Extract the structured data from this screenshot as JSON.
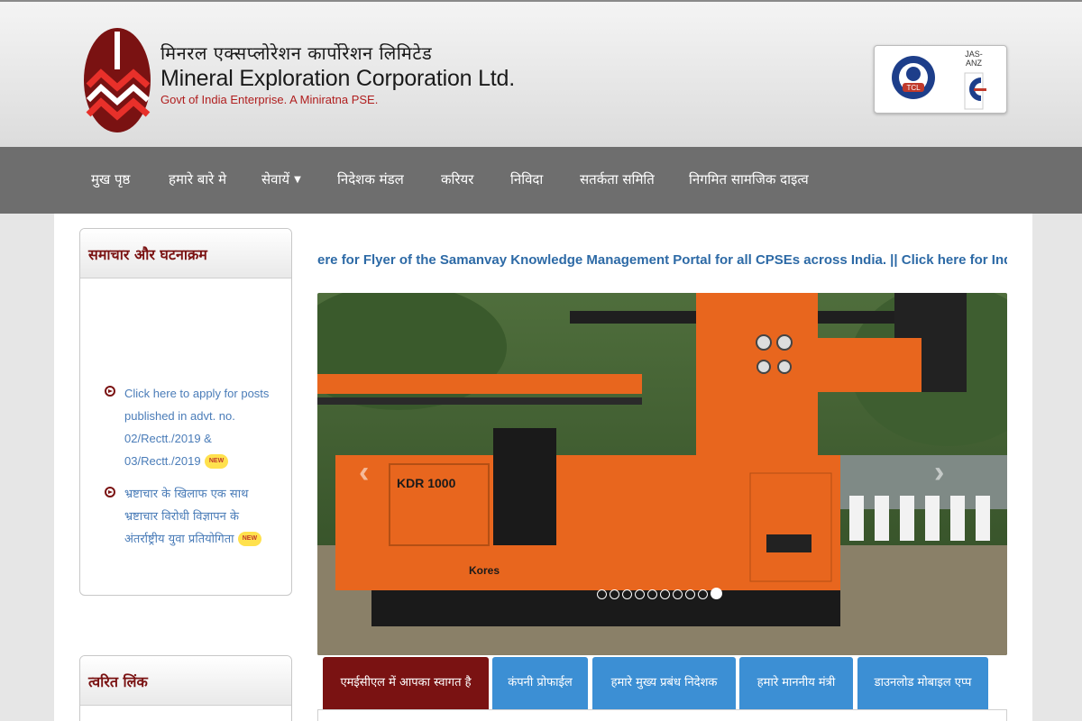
{
  "header": {
    "title_hindi": "मिनरल एक्सप्लोरेशन कार्पोरेशन लिमिटेड",
    "title_english": "Mineral Exploration Corporation Ltd.",
    "subtitle": "Govt of India Enterprise. A Miniratna PSE.",
    "cert_tcl_label": "TCL",
    "cert_jas_label": "JAS-ANZ"
  },
  "nav": {
    "items": [
      "मुख पृष्ठ",
      "हमारे बारे मे",
      "सेवायें",
      "निदेशक मंडल",
      "करियर",
      "निविदा",
      "सतर्कता समिति",
      "निगमित सामजिक दाइत्व"
    ]
  },
  "news": {
    "heading": "समाचार और घटनाक्रम",
    "items": [
      {
        "text": "Click here to apply for posts published in advt. no. 02/Rectt./2019 & 03/Rectt./2019",
        "badge": "NEW"
      },
      {
        "text": "भ्रष्टाचार के खिलाफ एक साथ भ्रष्टाचार विरोधी विज्ञापन के अंतर्राष्ट्रीय युवा प्रतियोगिता",
        "badge": "NEW"
      }
    ]
  },
  "quick_links": {
    "heading": "त्वरित लिंक"
  },
  "marquee_text": "ere for Flyer of the Samanvay Knowledge Management Portal for all CPSEs across India.  ||  Click here for India Investment G",
  "slider": {
    "machine_label": "Kores",
    "machine_model": "KDR 1000",
    "prev": "‹",
    "next": "›",
    "dot_count": 10,
    "active_dot": 10
  },
  "tabs": [
    "एमईसीएल में आपका स्वागत है",
    "कंपनी प्रोफाईल",
    "हमारे मुख्य प्रबंध निदेशक",
    "हमारे माननीय मंत्री",
    "डाउनलोड मोबाइल एप्प"
  ],
  "colors": {
    "brand_maroon": "#7a1212",
    "nav_gray": "#6e6e6e",
    "tab_blue": "#3c8fd4",
    "link_blue": "#4a7cb8"
  }
}
